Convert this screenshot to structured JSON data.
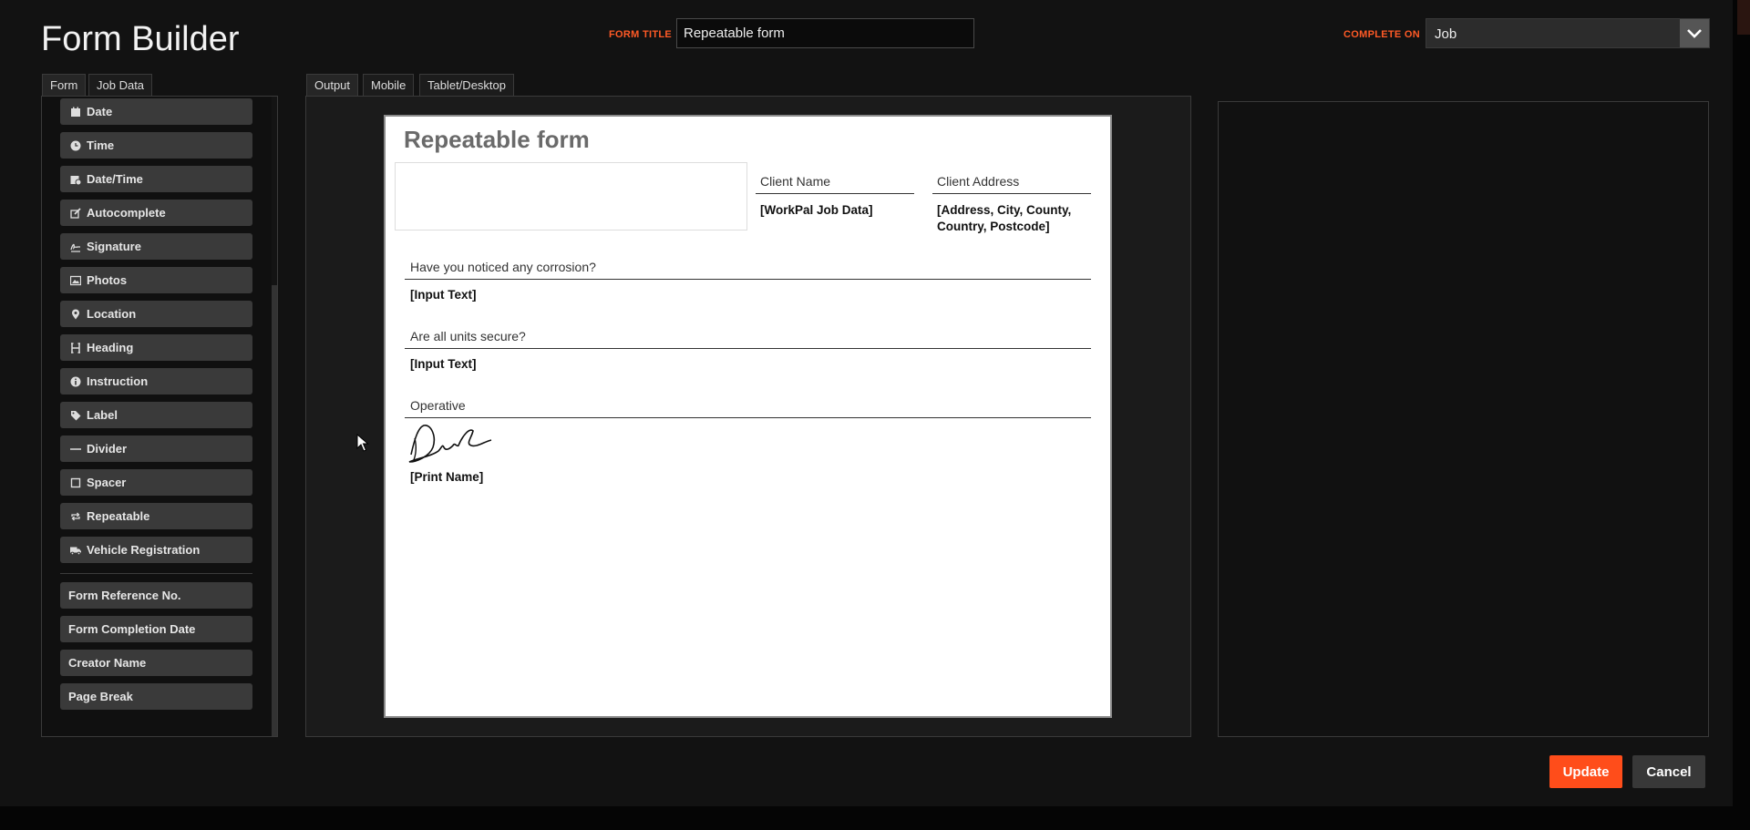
{
  "header": {
    "title": "Form Builder",
    "form_title_label": "FORM TITLE",
    "form_title_value": "Repeatable form",
    "complete_on_label": "COMPLETE ON",
    "complete_on_value": "Job"
  },
  "left_tabs": [
    {
      "label": "Form",
      "active": true
    },
    {
      "label": "Job Data",
      "active": false
    }
  ],
  "palette": {
    "items": [
      {
        "label": "Date",
        "icon": "calendar-icon"
      },
      {
        "label": "Time",
        "icon": "clock-icon"
      },
      {
        "label": "Date/Time",
        "icon": "calendar-clock-icon"
      },
      {
        "label": "Autocomplete",
        "icon": "edit-icon"
      },
      {
        "label": "Signature",
        "icon": "signature-icon"
      },
      {
        "label": "Photos",
        "icon": "image-icon"
      },
      {
        "label": "Location",
        "icon": "map-pin-icon"
      },
      {
        "label": "Heading",
        "icon": "heading-icon"
      },
      {
        "label": "Instruction",
        "icon": "info-icon"
      },
      {
        "label": "Label",
        "icon": "tag-icon"
      },
      {
        "label": "Divider",
        "icon": "line-icon"
      },
      {
        "label": "Spacer",
        "icon": "square-dashed-icon"
      },
      {
        "label": "Repeatable",
        "icon": "repeat-icon"
      },
      {
        "label": "Vehicle Registration",
        "icon": "truck-icon"
      }
    ],
    "system_items": [
      {
        "label": "Form Reference No."
      },
      {
        "label": "Form Completion Date"
      },
      {
        "label": "Creator Name"
      },
      {
        "label": "Page Break"
      }
    ]
  },
  "preview_tabs": [
    {
      "label": "Output",
      "active": true
    },
    {
      "label": "Mobile",
      "active": false
    },
    {
      "label": "Tablet/Desktop",
      "active": false
    }
  ],
  "form": {
    "title": "Repeatable form",
    "client_name_label": "Client Name",
    "client_name_value": "[WorkPal Job Data]",
    "client_address_label": "Client Address",
    "client_address_value_1": "[Address, City, County,",
    "client_address_value_2": "Country, Postcode]",
    "q1_label": "Have you noticed any corrosion?",
    "q1_value": "[Input Text]",
    "q2_label": "Are all units secure?",
    "q2_value": "[Input Text]",
    "operative_label": "Operative",
    "operative_value": "[Print Name]"
  },
  "actions": {
    "update_label": "Update",
    "cancel_label": "Cancel"
  },
  "colors": {
    "accent": "#ff4d1a",
    "background": "#121212",
    "panel_border": "#3a3a3a"
  }
}
